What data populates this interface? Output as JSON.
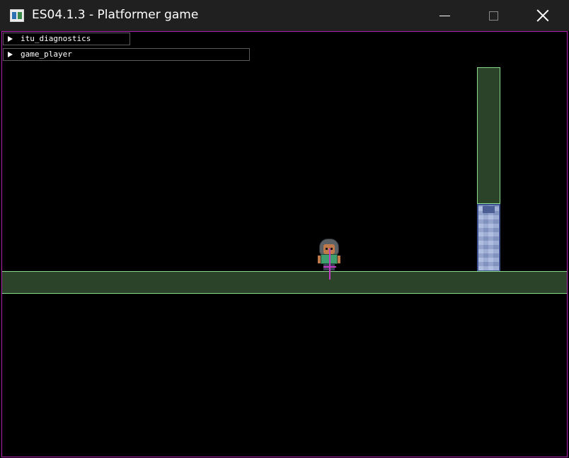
{
  "window": {
    "title": "ES04.1.3 - Platformer game",
    "icon": "app-window-icon",
    "controls": {
      "minimize_icon": "minimize-icon",
      "maximize_icon": "maximize-icon",
      "close_icon": "close-icon"
    }
  },
  "debug_panels": [
    {
      "label": "itu_diagnostics",
      "icon": "collapse-triangle-icon",
      "collapsed": true
    },
    {
      "label": "game_player",
      "icon": "collapse-triangle-icon",
      "collapsed": true
    }
  ],
  "colors": {
    "viewport_border": "#b01fb0",
    "collider_fill": "#2b4429",
    "collider_outline": "#8bd98b",
    "block_fill": "#8fa3d4",
    "pivot_marker": "#c23ac2"
  }
}
